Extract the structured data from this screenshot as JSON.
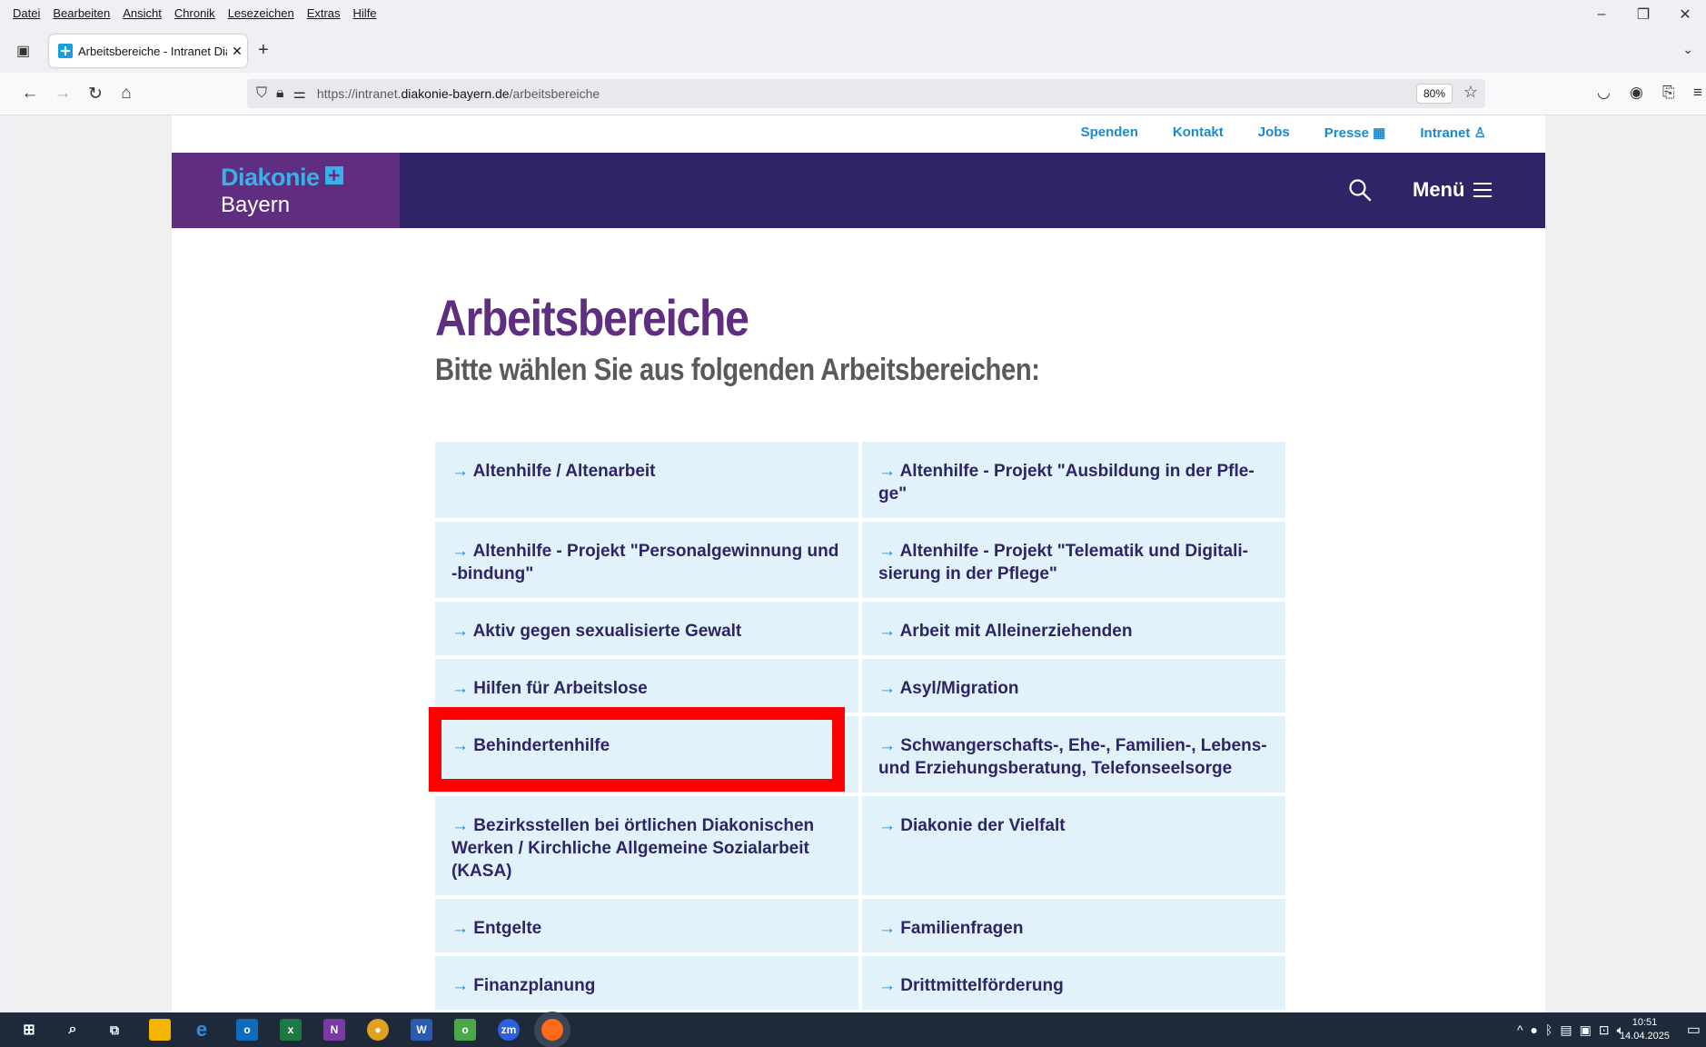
{
  "browser": {
    "menu": [
      "Datei",
      "Bearbeiten",
      "Ansicht",
      "Chronik",
      "Lesezeichen",
      "Extras",
      "Hilfe"
    ],
    "tab_title": "Arbeitsbereiche - Intranet Diakc",
    "url_prefix": "https://intranet.",
    "url_domain": "diakonie-bayern.de",
    "url_path": "/arbeitsbereiche",
    "zoom": "80%"
  },
  "site": {
    "utility_nav": [
      "Spenden",
      "Kontakt",
      "Jobs",
      "Presse",
      "Intranet"
    ],
    "logo_line1": "Diakonie",
    "logo_line2": "Bayern",
    "menu_label": "Menü",
    "title": "Arbeitsbereiche",
    "subtitle": "Bitte wählen Sie aus folgenden Arbeitsbereichen:",
    "arrow": "→",
    "areas": [
      [
        "Altenhilfe / Altenarbeit",
        "Altenhilfe - Projekt \"Ausbildung in der Pfle-ge\""
      ],
      [
        "Altenhilfe - Projekt \"Personalgewinnung und -bindung\"",
        "Altenhilfe - Projekt \"Telematik und Digitali-sierung in der Pflege\""
      ],
      [
        "Aktiv gegen sexualisierte Gewalt",
        "Arbeit mit Alleinerziehenden"
      ],
      [
        "Hilfen für Arbeitslose",
        "Asyl/Migration"
      ],
      [
        "Behindertenhilfe",
        "Schwangerschafts-, Ehe-, Familien-, Lebens- und Erziehungsberatung, Telefonseelsorge"
      ],
      [
        "Bezirksstellen bei örtlichen Diakonischen Werken / Kirchliche Allgemeine Sozialarbeit (KASA)",
        "Diakonie der Vielfalt"
      ],
      [
        "Entgelte",
        "Familienfragen"
      ],
      [
        "Finanzplanung",
        "Drittmittelförderung"
      ]
    ]
  },
  "taskbar": {
    "time": "10:51",
    "date": "14.04.2025"
  },
  "colors": {
    "brand_purple": "#602e80",
    "header_navy": "#2e2466",
    "accent_blue": "#1a8ad0",
    "tile_bg": "#e2f2fa",
    "highlight": "#ff0000"
  }
}
